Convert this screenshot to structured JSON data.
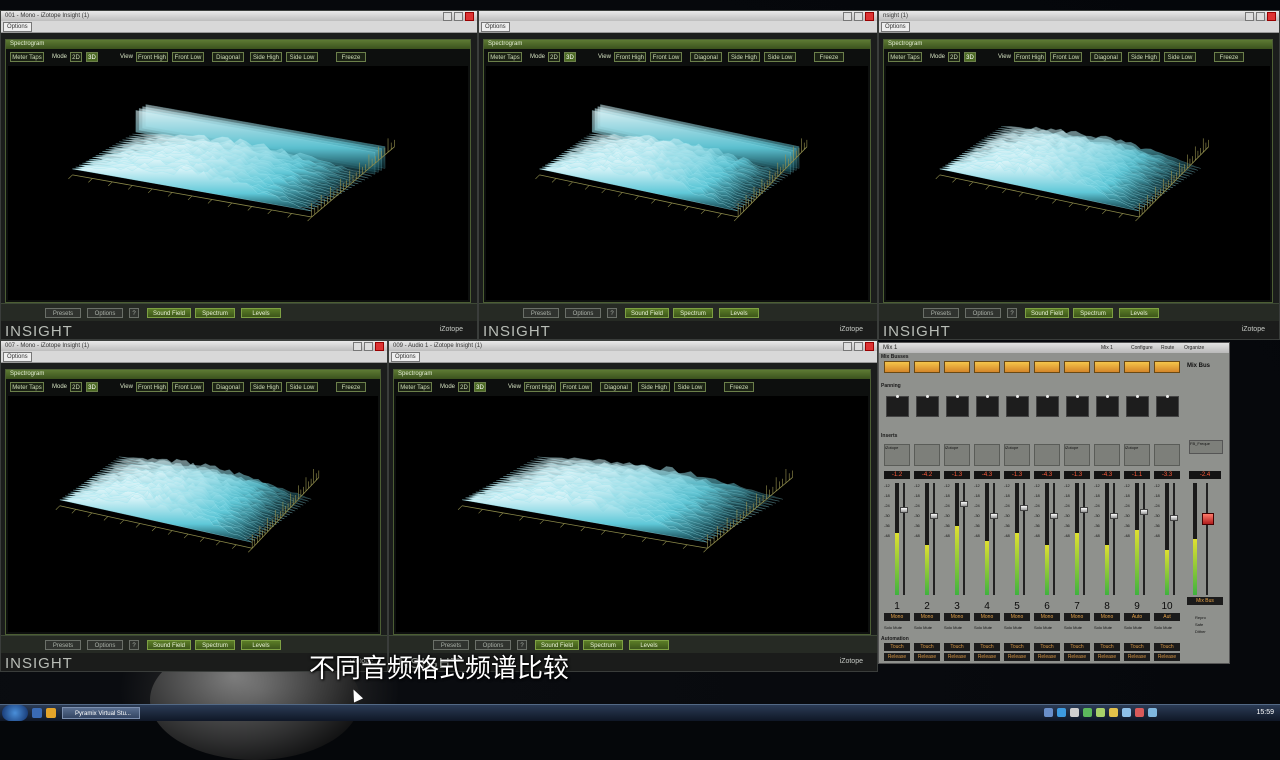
{
  "windows": [
    {
      "title": "001 - Mono - iZotope Insight (1)"
    },
    {
      "title": ""
    },
    {
      "title": "nsight (1)"
    },
    {
      "title": "007 - Mono - iZotope Insight (1)"
    },
    {
      "title": "009 - Audio 1 - iZotope Insight (1)"
    }
  ],
  "options_label": "Options",
  "spectrogram": {
    "panel_title": "Spectrogram",
    "meter_taps": "Meter Taps",
    "mode_label": "Mode",
    "mode_2d": "2D",
    "mode_3d": "3D",
    "view_label": "View",
    "views": [
      "Front High",
      "Front Low",
      "Diagonal",
      "Side High",
      "Side Low"
    ],
    "freeze": "Freeze"
  },
  "bottom": {
    "presets": "Presets",
    "options": "Options",
    "help": "?",
    "sound_field": "Sound Field",
    "spectrum": "Spectrum",
    "levels": "Levels"
  },
  "brand": {
    "insight": "INSIGHT",
    "izotope": "iZotope"
  },
  "mixer": {
    "title": "Mix 1",
    "menu": [
      "Mix 1",
      "Configure",
      "Route",
      "Organize"
    ],
    "mix_busses": "Mix Busses",
    "mix_bus": "Mix Bus",
    "panning": "Panning",
    "inserts": "Inserts",
    "automation": "Automation",
    "channels": [
      {
        "num": "1",
        "peak": "-1.2",
        "mode": "Mono",
        "insert": "iZotope"
      },
      {
        "num": "2",
        "peak": "-4.2",
        "mode": "Mono",
        "insert": ""
      },
      {
        "num": "3",
        "peak": "-1.3",
        "mode": "Mono",
        "insert": "iZotope"
      },
      {
        "num": "4",
        "peak": "-4.3",
        "mode": "Mono",
        "insert": ""
      },
      {
        "num": "5",
        "peak": "-1.3",
        "mode": "Mono",
        "insert": "iZotope"
      },
      {
        "num": "6",
        "peak": "-4.3",
        "mode": "Mono",
        "insert": ""
      },
      {
        "num": "7",
        "peak": "-1.3",
        "mode": "Mono",
        "insert": "iZotope"
      },
      {
        "num": "8",
        "peak": "-4.3",
        "mode": "Mono",
        "insert": ""
      },
      {
        "num": "9",
        "peak": "-1.1",
        "mode": "Auto",
        "insert": "iZotope"
      },
      {
        "num": "10",
        "peak": "-3.3",
        "mode": "Aut",
        "insert": ""
      }
    ],
    "master_peak": "-2.4",
    "master_insert": "FB_Freque",
    "solo": "Solo",
    "mute": "Mute",
    "touch": "Touch",
    "release": "Release",
    "repro": "Repro",
    "safe": "Safe",
    "dither": "Dither"
  },
  "taskbar": {
    "task_label": "Pyramix Virtual Stu...",
    "clock": "15:59"
  },
  "subtitle": "不同音频格式频谱比较",
  "colors": {
    "accent_green": "#5b7d27",
    "spectro_cyan": "#5fc8d8",
    "fader_orange": "#e39a3a"
  }
}
